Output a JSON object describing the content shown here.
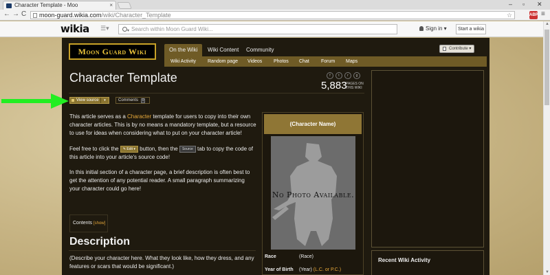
{
  "browser": {
    "tab_title": "Character Template - Moo",
    "tab_close": "×",
    "url_host": "moon-guard.wikia.com",
    "url_path": "/wiki/Character_Template",
    "star": "☆",
    "back": "←",
    "forward": "→",
    "reload": "C",
    "ext_label": "ABP",
    "menu": "≡",
    "win_min": "–",
    "win_max": "▫",
    "win_close": "✕"
  },
  "globalnav": {
    "logo": "wikia",
    "hub_menu": "☰▾",
    "search_placeholder": "Search within Moon Guard Wiki...",
    "search_caret": "▾",
    "signin": "Sign in ▾",
    "start_wiki": "Start a wikia"
  },
  "wiki": {
    "logo": "Moon Guard Wiki",
    "tabs": [
      {
        "label": "On the Wiki"
      },
      {
        "label": "Wiki Content"
      },
      {
        "label": "Community"
      }
    ],
    "subnav": [
      {
        "label": "Wiki Activity"
      },
      {
        "label": "Random page"
      },
      {
        "label": "Videos"
      },
      {
        "label": "Photos"
      },
      {
        "label": "Chat"
      },
      {
        "label": "Forum"
      },
      {
        "label": "Maps"
      }
    ],
    "contribute": "Contribute ▾"
  },
  "page": {
    "title": "Character Template",
    "social": [
      {
        "icon": "facebook-icon",
        "glyph": "f"
      },
      {
        "icon": "twitter-icon",
        "glyph": "t"
      },
      {
        "icon": "reddit-icon",
        "glyph": "r"
      },
      {
        "icon": "google-plus-icon",
        "glyph": "g"
      }
    ],
    "page_count": "5,883",
    "page_count_label": "PAGES ON THIS WIKI",
    "view_source": "View source",
    "view_source_dd": "▾",
    "comments": "Comments",
    "comments_count": "0",
    "p1_before": "This article serves as a ",
    "p1_link": "Character",
    "p1_after": " template for users to copy into their own character articles. This is by no means a mandatory template, but a resource to use for ideas when considering what to put on your character article!",
    "p2_a": "Feel free to click the ",
    "p2_edit": "✎ Edit ▾",
    "p2_b": " button, then the ",
    "p2_source": "Source",
    "p2_c": " tab to copy the code of this article into your article's source code!",
    "p3": "In this initial section of a character page, a brief description is often best to get the attention of any potential reader. A small paragraph summarizing your character could go here!",
    "toc_label": "Contents ",
    "toc_show": "[show]",
    "section_title": "Description",
    "section_text": "(Describe your character here. What they look like, how they dress, and any features or scars that would be significant.)"
  },
  "infobox": {
    "title": "(Character Name)",
    "image_caption": "No Photo Available.",
    "race_key": "Race",
    "race_val": "(Race)",
    "yob_key": "Year of Birth",
    "yob_val": "(Year) ",
    "yob_link": "(L.C. or P.C.)"
  },
  "rail": {
    "activity_title": "Recent Wiki Activity"
  },
  "colors": {
    "accent_gold": "#8f7635",
    "link": "#e6a83a",
    "arrow_green": "#22ee22"
  }
}
